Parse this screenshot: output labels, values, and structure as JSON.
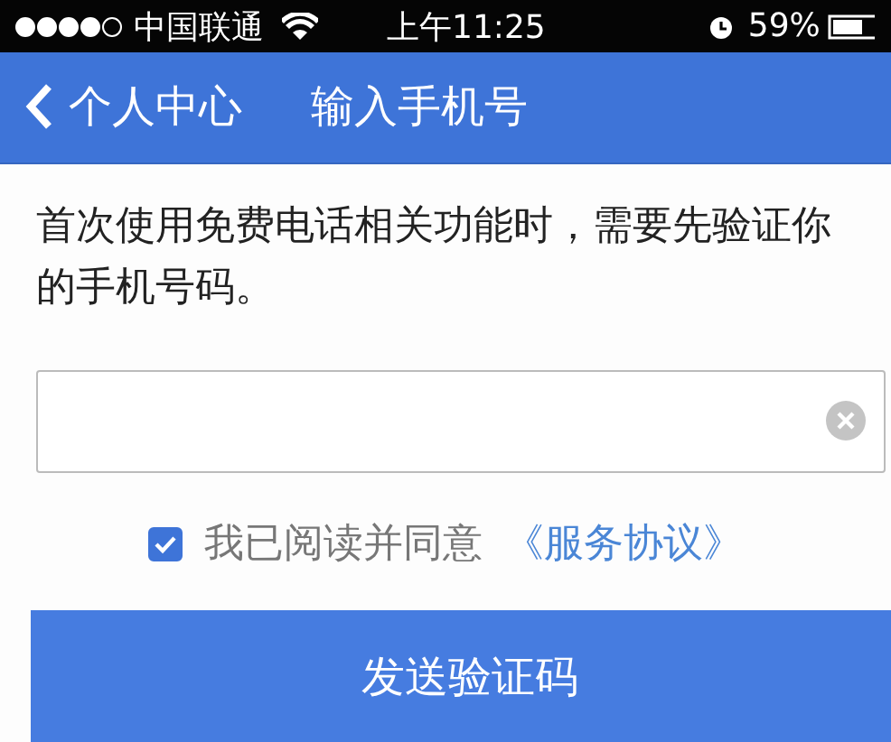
{
  "status_bar": {
    "carrier": "中国联通",
    "time": "上午11:25",
    "battery": "59%"
  },
  "nav_bar": {
    "back": "个人中心",
    "title": "输入手机号"
  },
  "message": "首次使用免费电话相关功能时，需要先验证你的手机号码。",
  "agreement": {
    "checked": true,
    "text": "我已阅读并同意",
    "link": "《服务协议》"
  },
  "submit_button": "发送验证码"
}
